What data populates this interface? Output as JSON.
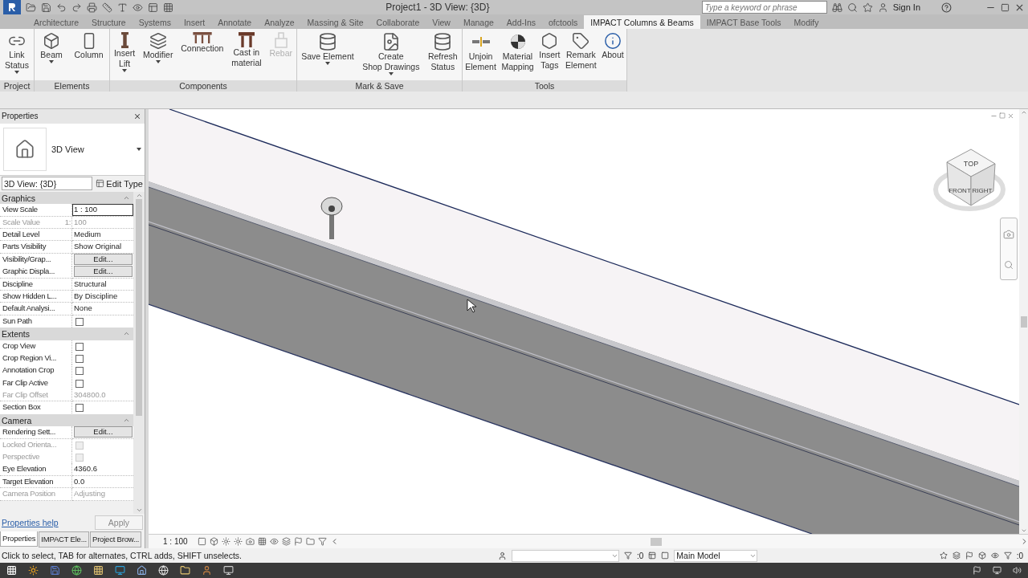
{
  "window": {
    "title": "Project1 - 3D View: {3D}"
  },
  "search": {
    "placeholder": "Type a keyword or phrase"
  },
  "account": {
    "label": "Sign In"
  },
  "tabs": [
    {
      "label": "Architecture",
      "selected": false
    },
    {
      "label": "Structure",
      "selected": false
    },
    {
      "label": "Systems",
      "selected": false
    },
    {
      "label": "Insert",
      "selected": false
    },
    {
      "label": "Annotate",
      "selected": false
    },
    {
      "label": "Analyze",
      "selected": false
    },
    {
      "label": "Massing & Site",
      "selected": false
    },
    {
      "label": "Collaborate",
      "selected": false
    },
    {
      "label": "View",
      "selected": false
    },
    {
      "label": "Manage",
      "selected": false
    },
    {
      "label": "Add-Ins",
      "selected": false
    },
    {
      "label": "ofctools",
      "selected": false
    },
    {
      "label": "IMPACT Columns & Beams",
      "selected": true
    },
    {
      "label": "IMPACT Base Tools",
      "selected": false
    },
    {
      "label": "Modify",
      "selected": false
    }
  ],
  "ribbon": {
    "panels": [
      {
        "title": "Project",
        "buttons": [
          {
            "lines": [
              "Link",
              "Status"
            ],
            "dropdown": true,
            "disabled": false
          }
        ]
      },
      {
        "title": "Elements",
        "buttons": [
          {
            "lines": [
              "Beam"
            ],
            "dropdown": true,
            "disabled": false
          },
          {
            "lines": [
              "Column"
            ],
            "dropdown": false,
            "disabled": false
          }
        ]
      },
      {
        "title": "Components",
        "buttons": [
          {
            "lines": [
              "Insert",
              "Lift"
            ],
            "dropdown": true,
            "disabled": false
          },
          {
            "lines": [
              "Modifier"
            ],
            "dropdown": true,
            "disabled": false
          },
          {
            "lines": [
              "Connection"
            ],
            "dropdown": false,
            "disabled": false
          },
          {
            "lines": [
              "Cast in",
              "material"
            ],
            "dropdown": false,
            "disabled": false
          },
          {
            "lines": [
              "Rebar"
            ],
            "dropdown": false,
            "disabled": true
          }
        ]
      },
      {
        "title": "Mark & Save",
        "buttons": [
          {
            "lines": [
              "Save Element"
            ],
            "dropdown": true,
            "disabled": false
          },
          {
            "lines": [
              "Create",
              "Shop Drawings"
            ],
            "dropdown": true,
            "disabled": false
          },
          {
            "lines": [
              "Refresh",
              "Status"
            ],
            "dropdown": false,
            "disabled": false
          }
        ]
      },
      {
        "title": "Tools",
        "buttons": [
          {
            "lines": [
              "Unjoin",
              "Element"
            ],
            "dropdown": false,
            "disabled": false
          },
          {
            "lines": [
              "Material",
              "Mapping"
            ],
            "dropdown": false,
            "disabled": false
          },
          {
            "lines": [
              "Insert",
              "Tags"
            ],
            "dropdown": false,
            "disabled": false
          },
          {
            "lines": [
              "Remark",
              "Element"
            ],
            "dropdown": false,
            "disabled": false
          },
          {
            "lines": [
              "About"
            ],
            "dropdown": false,
            "disabled": false
          }
        ]
      }
    ]
  },
  "properties": {
    "title": "Properties",
    "type_name": "3D View",
    "view_select": "3D View: {3D}",
    "edit_type": "Edit Type",
    "rows": [
      {
        "kind": "header",
        "label": "Graphics",
        "expanded": true
      },
      {
        "kind": "text",
        "label": "View Scale",
        "value": "1 : 100",
        "selected": true,
        "disabled": false
      },
      {
        "kind": "text",
        "label": "Scale Value",
        "prefix": "1:",
        "value": "100",
        "selected": false,
        "disabled": true
      },
      {
        "kind": "text",
        "label": "Detail Level",
        "value": "Medium",
        "selected": false,
        "disabled": false
      },
      {
        "kind": "text",
        "label": "Parts Visibility",
        "value": "Show Original",
        "selected": false,
        "disabled": false
      },
      {
        "kind": "edit",
        "label": "Visibility/Grap...",
        "value": "Edit...",
        "selected": false,
        "disabled": false
      },
      {
        "kind": "edit",
        "label": "Graphic Displa...",
        "value": "Edit...",
        "selected": false,
        "disabled": false
      },
      {
        "kind": "text",
        "label": "Discipline",
        "value": "Structural",
        "selected": false,
        "disabled": false
      },
      {
        "kind": "text",
        "label": "Show Hidden L...",
        "value": "By Discipline",
        "selected": false,
        "disabled": false
      },
      {
        "kind": "text",
        "label": "Default Analysi...",
        "value": "None",
        "selected": false,
        "disabled": false
      },
      {
        "kind": "checkbox",
        "label": "Sun Path",
        "checked": false,
        "selected": false,
        "disabled": false
      },
      {
        "kind": "header",
        "label": "Extents",
        "expanded": true
      },
      {
        "kind": "checkbox",
        "label": "Crop View",
        "checked": false,
        "selected": false,
        "disabled": false
      },
      {
        "kind": "checkbox",
        "label": "Crop Region Vi...",
        "checked": false,
        "selected": false,
        "disabled": false
      },
      {
        "kind": "checkbox",
        "label": "Annotation Crop",
        "checked": false,
        "selected": false,
        "disabled": false
      },
      {
        "kind": "checkbox",
        "label": "Far Clip Active",
        "checked": false,
        "selected": false,
        "disabled": false
      },
      {
        "kind": "text",
        "label": "Far Clip Offset",
        "value": "304800.0",
        "selected": false,
        "disabled": true
      },
      {
        "kind": "checkbox",
        "label": "Section Box",
        "checked": false,
        "selected": false,
        "disabled": false
      },
      {
        "kind": "header",
        "label": "Camera",
        "expanded": true
      },
      {
        "kind": "edit",
        "label": "Rendering Sett...",
        "value": "Edit...",
        "selected": false,
        "disabled": false
      },
      {
        "kind": "checkbox",
        "label": "Locked Orienta...",
        "checked": false,
        "selected": false,
        "disabled": true
      },
      {
        "kind": "checkbox",
        "label": "Perspective",
        "checked": false,
        "selected": false,
        "disabled": true
      },
      {
        "kind": "text",
        "label": "Eye Elevation",
        "value": "4360.6",
        "selected": false,
        "disabled": false
      },
      {
        "kind": "text",
        "label": "Target Elevation",
        "value": "0.0",
        "selected": false,
        "disabled": false
      },
      {
        "kind": "text",
        "label": "Camera Position",
        "value": "Adjusting",
        "selected": false,
        "disabled": true
      }
    ],
    "help_link": "Properties help",
    "apply": {
      "label": "Apply",
      "disabled": true
    }
  },
  "browser_tabs": [
    {
      "label": "Properties",
      "selected": true
    },
    {
      "label": "IMPACT Ele...",
      "selected": false
    },
    {
      "label": "Project Brow...",
      "selected": false
    }
  ],
  "view_bar": {
    "scale": "1 : 100"
  },
  "viewcube": {
    "labels": [
      "TOP",
      "FRONT",
      "RIGHT"
    ]
  },
  "status_bar": {
    "message": "Click to select, TAB for alternates, CTRL adds, SHIFT unselects.",
    "selection_count": ":0",
    "model": "Main Model",
    "filter_count": ":0"
  }
}
